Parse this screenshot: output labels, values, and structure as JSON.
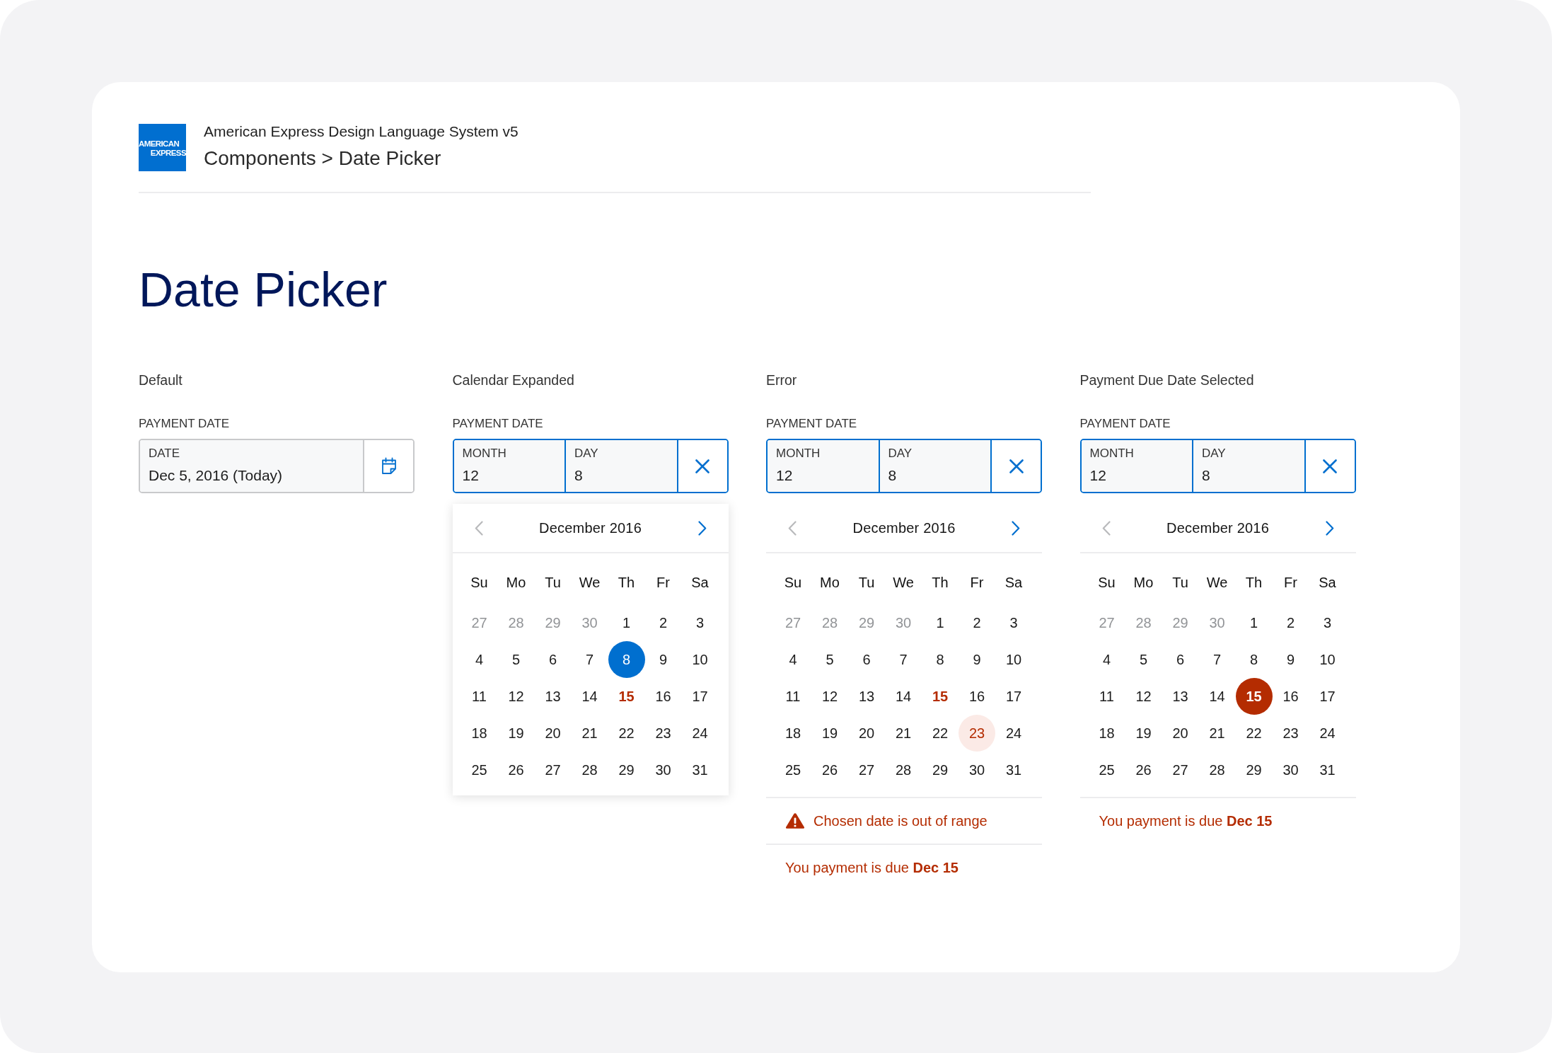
{
  "header": {
    "logo_lines": [
      "AMERICAN",
      "EXPRESS"
    ],
    "title": "American Express Design Language System v5",
    "breadcrumb": "Components > Date Picker"
  },
  "page_title": "Date Picker",
  "variants": [
    {
      "caption": "Default",
      "field_label": "PAYMENT DATE",
      "focused": false,
      "segments": [
        {
          "label": "DATE",
          "value": "Dec 5, 2016 (Today)"
        }
      ],
      "action": {
        "kind": "calendar"
      }
    },
    {
      "caption": "Calendar Expanded",
      "field_label": "PAYMENT DATE",
      "focused": true,
      "segments": [
        {
          "label": "MONTH",
          "value": "12"
        },
        {
          "label": "DAY",
          "value": "8"
        }
      ],
      "action": {
        "kind": "clear"
      },
      "calendar": {
        "kind": "popover",
        "month": "December 2016",
        "prev_disabled": true,
        "next_disabled": false,
        "weekdays": [
          "Su",
          "Mo",
          "Tu",
          "We",
          "Th",
          "Fr",
          "Sa"
        ],
        "days": [
          {
            "label": "27",
            "kind": "outside",
            "selected": false
          },
          {
            "label": "28",
            "kind": "outside",
            "selected": false
          },
          {
            "label": "29",
            "kind": "outside",
            "selected": false
          },
          {
            "label": "30",
            "kind": "outside",
            "selected": false
          },
          {
            "label": "1",
            "kind": "current",
            "selected": false
          },
          {
            "label": "2",
            "kind": "current",
            "selected": false
          },
          {
            "label": "3",
            "kind": "current",
            "selected": false
          },
          {
            "label": "4",
            "kind": "current",
            "selected": false
          },
          {
            "label": "5",
            "kind": "current",
            "selected": false
          },
          {
            "label": "6",
            "kind": "current",
            "selected": false
          },
          {
            "label": "7",
            "kind": "current",
            "selected": false
          },
          {
            "label": "8",
            "kind": "current",
            "selected": true
          },
          {
            "label": "9",
            "kind": "current",
            "selected": false
          },
          {
            "label": "10",
            "kind": "current",
            "selected": false
          },
          {
            "label": "11",
            "kind": "current",
            "selected": false
          },
          {
            "label": "12",
            "kind": "current",
            "selected": false
          },
          {
            "label": "13",
            "kind": "current",
            "selected": false
          },
          {
            "label": "14",
            "kind": "current",
            "selected": false
          },
          {
            "label": "15",
            "kind": "due",
            "selected": false
          },
          {
            "label": "16",
            "kind": "current",
            "selected": false
          },
          {
            "label": "17",
            "kind": "current",
            "selected": false
          },
          {
            "label": "18",
            "kind": "current",
            "selected": false
          },
          {
            "label": "19",
            "kind": "current",
            "selected": false
          },
          {
            "label": "20",
            "kind": "current",
            "selected": false
          },
          {
            "label": "21",
            "kind": "current",
            "selected": false
          },
          {
            "label": "22",
            "kind": "current",
            "selected": false
          },
          {
            "label": "23",
            "kind": "current",
            "selected": false
          },
          {
            "label": "24",
            "kind": "current",
            "selected": false
          },
          {
            "label": "25",
            "kind": "current",
            "selected": false
          },
          {
            "label": "26",
            "kind": "current",
            "selected": false
          },
          {
            "label": "27",
            "kind": "current",
            "selected": false
          },
          {
            "label": "28",
            "kind": "current",
            "selected": false
          },
          {
            "label": "29",
            "kind": "current",
            "selected": false
          },
          {
            "label": "30",
            "kind": "current",
            "selected": false
          },
          {
            "label": "31",
            "kind": "current",
            "selected": false
          }
        ]
      }
    },
    {
      "caption": "Error",
      "field_label": "PAYMENT DATE",
      "focused": true,
      "segments": [
        {
          "label": "MONTH",
          "value": "12"
        },
        {
          "label": "DAY",
          "value": "8"
        }
      ],
      "action": {
        "kind": "clear"
      },
      "calendar": {
        "kind": "inline",
        "month": "December 2016",
        "prev_disabled": true,
        "next_disabled": false,
        "weekdays": [
          "Su",
          "Mo",
          "Tu",
          "We",
          "Th",
          "Fr",
          "Sa"
        ],
        "days": [
          {
            "label": "27",
            "kind": "outside",
            "selected": false
          },
          {
            "label": "28",
            "kind": "outside",
            "selected": false
          },
          {
            "label": "29",
            "kind": "outside",
            "selected": false
          },
          {
            "label": "30",
            "kind": "outside",
            "selected": false
          },
          {
            "label": "1",
            "kind": "current",
            "selected": false
          },
          {
            "label": "2",
            "kind": "current",
            "selected": false
          },
          {
            "label": "3",
            "kind": "current",
            "selected": false
          },
          {
            "label": "4",
            "kind": "current",
            "selected": false
          },
          {
            "label": "5",
            "kind": "current",
            "selected": false
          },
          {
            "label": "6",
            "kind": "current",
            "selected": false
          },
          {
            "label": "7",
            "kind": "current",
            "selected": false
          },
          {
            "label": "8",
            "kind": "current",
            "selected": false
          },
          {
            "label": "9",
            "kind": "current",
            "selected": false
          },
          {
            "label": "10",
            "kind": "current",
            "selected": false
          },
          {
            "label": "11",
            "kind": "current",
            "selected": false
          },
          {
            "label": "12",
            "kind": "current",
            "selected": false
          },
          {
            "label": "13",
            "kind": "current",
            "selected": false
          },
          {
            "label": "14",
            "kind": "current",
            "selected": false
          },
          {
            "label": "15",
            "kind": "due",
            "selected": false
          },
          {
            "label": "16",
            "kind": "current",
            "selected": false
          },
          {
            "label": "17",
            "kind": "current",
            "selected": false
          },
          {
            "label": "18",
            "kind": "current",
            "selected": false
          },
          {
            "label": "19",
            "kind": "current",
            "selected": false
          },
          {
            "label": "20",
            "kind": "current",
            "selected": false
          },
          {
            "label": "21",
            "kind": "current",
            "selected": false
          },
          {
            "label": "22",
            "kind": "current",
            "selected": false
          },
          {
            "label": "23",
            "kind": "current",
            "selected": true
          },
          {
            "label": "24",
            "kind": "current",
            "selected": false
          },
          {
            "label": "25",
            "kind": "current",
            "selected": false
          },
          {
            "label": "26",
            "kind": "current",
            "selected": false
          },
          {
            "label": "27",
            "kind": "current",
            "selected": false
          },
          {
            "label": "28",
            "kind": "current",
            "selected": false
          },
          {
            "label": "29",
            "kind": "current",
            "selected": false
          },
          {
            "label": "30",
            "kind": "current",
            "selected": false
          },
          {
            "label": "31",
            "kind": "current",
            "selected": false
          }
        ]
      },
      "error": "Chosen date is out of range",
      "note": "You payment is due **Dec 15**"
    },
    {
      "caption": "Payment Due Date Selected",
      "field_label": "PAYMENT DATE",
      "focused": true,
      "segments": [
        {
          "label": "MONTH",
          "value": "12"
        },
        {
          "label": "DAY",
          "value": "8"
        }
      ],
      "action": {
        "kind": "clear"
      },
      "calendar": {
        "kind": "inline",
        "month": "December 2016",
        "prev_disabled": true,
        "next_disabled": false,
        "weekdays": [
          "Su",
          "Mo",
          "Tu",
          "We",
          "Th",
          "Fr",
          "Sa"
        ],
        "days": [
          {
            "label": "27",
            "kind": "outside",
            "selected": false
          },
          {
            "label": "28",
            "kind": "outside",
            "selected": false
          },
          {
            "label": "29",
            "kind": "outside",
            "selected": false
          },
          {
            "label": "30",
            "kind": "outside",
            "selected": false
          },
          {
            "label": "1",
            "kind": "current",
            "selected": false
          },
          {
            "label": "2",
            "kind": "current",
            "selected": false
          },
          {
            "label": "3",
            "kind": "current",
            "selected": false
          },
          {
            "label": "4",
            "kind": "current",
            "selected": false
          },
          {
            "label": "5",
            "kind": "current",
            "selected": false
          },
          {
            "label": "6",
            "kind": "current",
            "selected": false
          },
          {
            "label": "7",
            "kind": "current",
            "selected": false
          },
          {
            "label": "8",
            "kind": "current",
            "selected": false
          },
          {
            "label": "9",
            "kind": "current",
            "selected": false
          },
          {
            "label": "10",
            "kind": "current",
            "selected": false
          },
          {
            "label": "11",
            "kind": "current",
            "selected": false
          },
          {
            "label": "12",
            "kind": "current",
            "selected": false
          },
          {
            "label": "13",
            "kind": "current",
            "selected": false
          },
          {
            "label": "14",
            "kind": "current",
            "selected": false
          },
          {
            "label": "15",
            "kind": "due",
            "selected": true
          },
          {
            "label": "16",
            "kind": "current",
            "selected": false
          },
          {
            "label": "17",
            "kind": "current",
            "selected": false
          },
          {
            "label": "18",
            "kind": "current",
            "selected": false
          },
          {
            "label": "19",
            "kind": "current",
            "selected": false
          },
          {
            "label": "20",
            "kind": "current",
            "selected": false
          },
          {
            "label": "21",
            "kind": "current",
            "selected": false
          },
          {
            "label": "22",
            "kind": "current",
            "selected": false
          },
          {
            "label": "23",
            "kind": "current",
            "selected": false
          },
          {
            "label": "24",
            "kind": "current",
            "selected": false
          },
          {
            "label": "25",
            "kind": "current",
            "selected": false
          },
          {
            "label": "26",
            "kind": "current",
            "selected": false
          },
          {
            "label": "27",
            "kind": "current",
            "selected": false
          },
          {
            "label": "28",
            "kind": "current",
            "selected": false
          },
          {
            "label": "29",
            "kind": "current",
            "selected": false
          },
          {
            "label": "30",
            "kind": "current",
            "selected": false
          },
          {
            "label": "31",
            "kind": "current",
            "selected": false
          }
        ]
      },
      "note": "You payment is due **Dec 15**"
    }
  ]
}
